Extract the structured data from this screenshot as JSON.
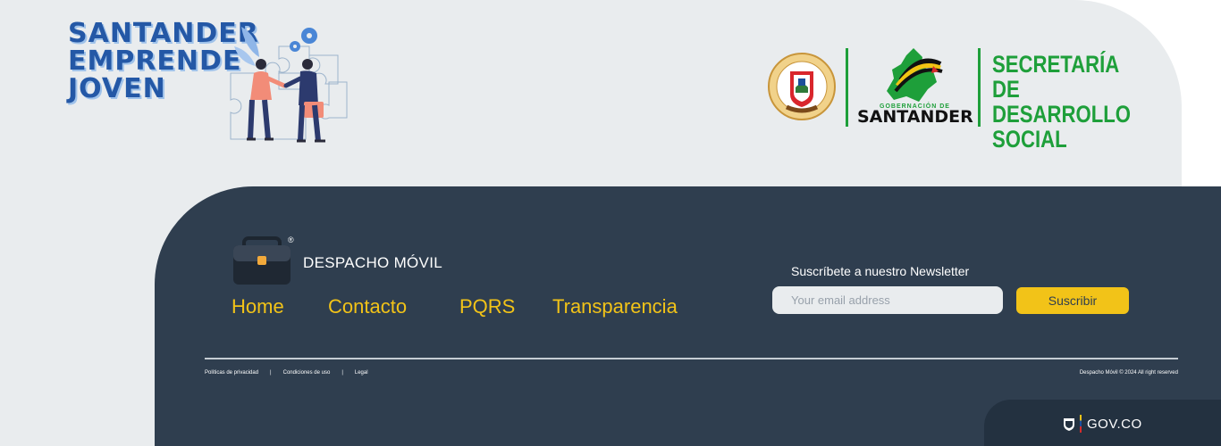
{
  "header": {
    "brand_lines": [
      "SANTANDER",
      "EMPRENDE",
      "JOVEN"
    ],
    "seal": {
      "top_text": "DEPARTAMENTO DE SANTANDER",
      "motto": "NADIE ABAJO"
    },
    "gobernacion": {
      "small": "GOBERNACIÓN DE",
      "big": "SANTANDER"
    },
    "secretaria_lines": [
      "SECRETARÍA DE",
      "DESARROLLO",
      "SOCIAL"
    ]
  },
  "footer": {
    "logo_label": "DESPACHO MÓVIL",
    "registered_mark": "®",
    "nav": [
      "Home",
      "Contacto",
      "PQRS",
      "Transparencia"
    ],
    "newsletter": {
      "title": "Suscríbete a nuestro Newsletter",
      "placeholder": "Your email address",
      "button": "Suscribir"
    },
    "legal_links": [
      "Políticas de privacidad",
      "Condiciones de uso",
      "Legal"
    ],
    "separator": "|",
    "copyright": "Despacho Móvil © 2024 All right reserved"
  },
  "govbar": {
    "label": "GOV.CO"
  },
  "colors": {
    "brand_blue": "#2458a6",
    "green": "#1e9f3a",
    "footer_bg": "#2f3e4f",
    "accent_yellow": "#f2c318",
    "light_bg": "#e9ecee"
  },
  "icons": [
    "puzzle-handshake-illustration",
    "department-seal-icon",
    "santander-map-icon",
    "briefcase-icon",
    "colombia-shield-icon"
  ]
}
